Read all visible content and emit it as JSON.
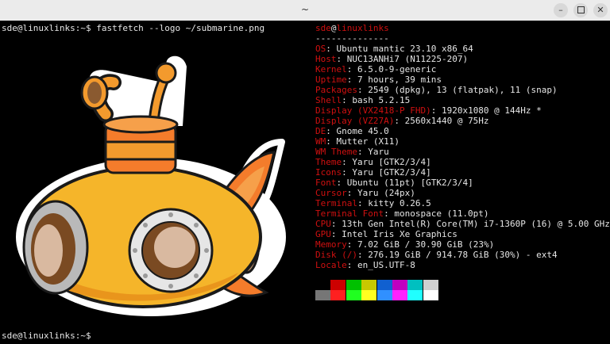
{
  "window": {
    "title": "~",
    "minimize_icon": "minimize-icon",
    "maximize_icon": "maximize-icon",
    "close_icon": "close-icon"
  },
  "terminal": {
    "command_line": "sde@linuxlinks:~$ fastfetch --logo ~/submarine.png",
    "prompt_line": "sde@linuxlinks:~$",
    "logo": "submarine-logo"
  },
  "info": {
    "user": "sde",
    "at": "@",
    "host": "linuxlinks",
    "separator": "--------------",
    "rows": [
      {
        "key": "OS",
        "value": "Ubuntu mantic 23.10 x86_64"
      },
      {
        "key": "Host",
        "value": "NUC13ANHi7 (N11225-207)"
      },
      {
        "key": "Kernel",
        "value": "6.5.0-9-generic"
      },
      {
        "key": "Uptime",
        "value": "7 hours, 39 mins"
      },
      {
        "key": "Packages",
        "value": "2549 (dpkg), 13 (flatpak), 11 (snap)"
      },
      {
        "key": "Shell",
        "value": "bash 5.2.15"
      },
      {
        "key": "Display (VX2418-P FHD)",
        "value": "1920x1080 @ 144Hz *"
      },
      {
        "key": "Display (VZ27A)",
        "value": "2560x1440 @ 75Hz"
      },
      {
        "key": "DE",
        "value": "Gnome 45.0"
      },
      {
        "key": "WM",
        "value": "Mutter (X11)"
      },
      {
        "key": "WM Theme",
        "value": "Yaru"
      },
      {
        "key": "Theme",
        "value": "Yaru [GTK2/3/4]"
      },
      {
        "key": "Icons",
        "value": "Yaru [GTK2/3/4]"
      },
      {
        "key": "Font",
        "value": "Ubuntu (11pt) [GTK2/3/4]"
      },
      {
        "key": "Cursor",
        "value": "Yaru (24px)"
      },
      {
        "key": "Terminal",
        "value": "kitty 0.26.5"
      },
      {
        "key": "Terminal Font",
        "value": "monospace (11.0pt)"
      },
      {
        "key": "CPU",
        "value": "13th Gen Intel(R) Core(TM) i7-1360P (16) @ 5.00 GHz"
      },
      {
        "key": "GPU",
        "value": "Intel Iris Xe Graphics"
      },
      {
        "key": "Memory",
        "value": "7.02 GiB / 30.90 GiB (23%)"
      },
      {
        "key": "Disk (/)",
        "value": "276.19 GiB / 914.78 GiB (30%) - ext4"
      },
      {
        "key": "Locale",
        "value": "en_US.UTF-8"
      }
    ],
    "palette_top": [
      "#000000",
      "#cc0000",
      "#00c000",
      "#c8c800",
      "#1060d0",
      "#c000c0",
      "#00c0c0",
      "#d0d0d0"
    ],
    "palette_bottom": [
      "#767676",
      "#ff2020",
      "#20ff20",
      "#ffff20",
      "#3090ff",
      "#ff20ff",
      "#20ffff",
      "#ffffff"
    ]
  }
}
